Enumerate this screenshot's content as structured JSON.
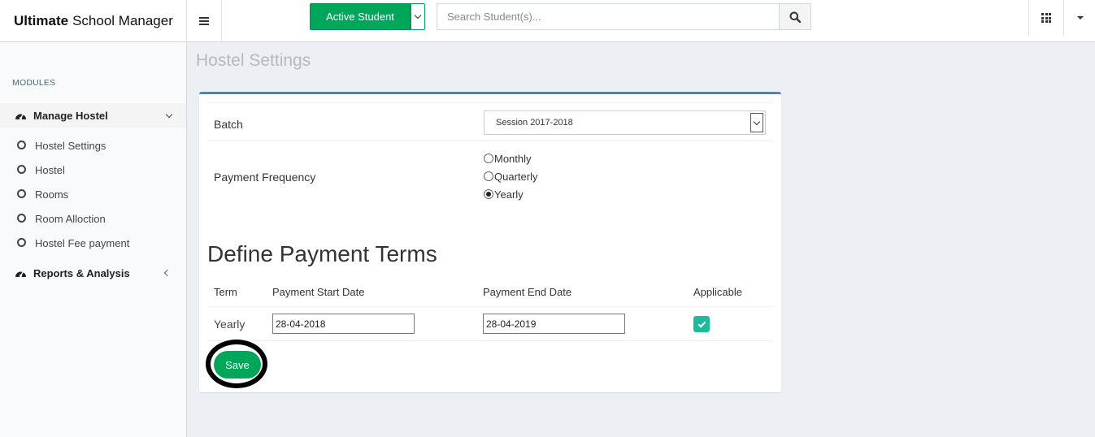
{
  "header": {
    "brand_bold": "Ultimate",
    "brand_rest": "School Manager",
    "active_student_label": "Active Student",
    "search_placeholder": "Search Student(s)..."
  },
  "sidebar": {
    "modules_heading": "MODULES",
    "manage_hostel": {
      "label": "Manage Hostel",
      "items": [
        "Hostel Settings",
        "Hostel",
        "Rooms",
        "Room Alloction",
        "Hostel Fee payment"
      ]
    },
    "reports_label": "Reports & Analysis"
  },
  "page": {
    "title": "Hostel Settings",
    "batch_label": "Batch",
    "batch_value": "Session 2017-2018",
    "payment_frequency_label": "Payment Frequency",
    "frequency_options": [
      "Monthly",
      "Quarterly",
      "Yearly"
    ],
    "frequency_selected": "Yearly",
    "section_heading": "Define Payment Terms",
    "table_headers": [
      "Term",
      "Payment Start Date",
      "Payment End Date",
      "Applicable"
    ],
    "row": {
      "term": "Yearly",
      "start_date": "28-04-2018",
      "end_date": "28-04-2019",
      "applicable": true
    },
    "save_label": "Save"
  },
  "colors": {
    "accent_green": "#00a65a",
    "box_top_border": "#3c8dbc",
    "checkbox_teal": "#1abc9c"
  }
}
